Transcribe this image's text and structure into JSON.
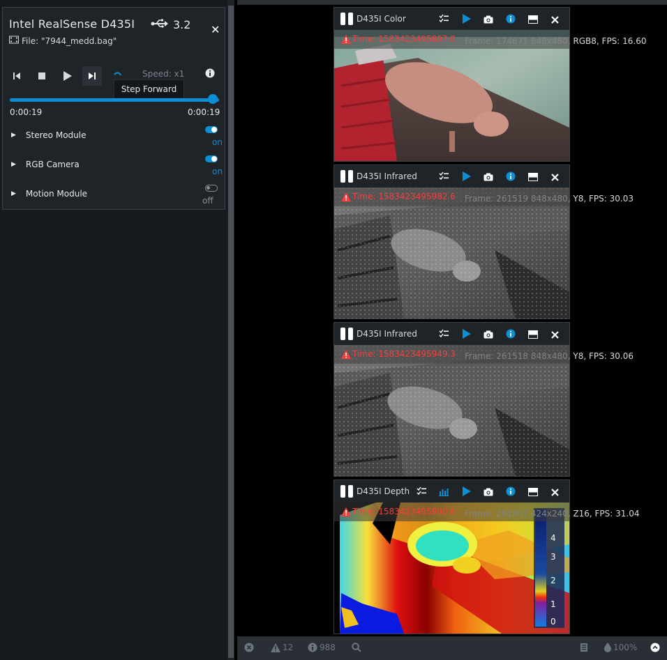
{
  "device": {
    "title": "Intel RealSense D435I",
    "usb_version": "3.2",
    "file_label": "File: \"7944_medd.bag\"",
    "speed_label": "Speed: x1",
    "tooltip": "Step Forward",
    "time_start": "0:00:19",
    "time_end": "0:00:19",
    "progress": 1.0,
    "modules": [
      {
        "label": "Stereo Module",
        "state": "on"
      },
      {
        "label": "RGB Camera",
        "state": "on"
      },
      {
        "label": "Motion Module",
        "state": "off"
      }
    ]
  },
  "streams": [
    {
      "name": "D435I Color",
      "time": "Time: 1583423495897.0",
      "info": "Frame: 174671  848x480,  RGB8,   FPS:  16.60"
    },
    {
      "name": "D435I Infrared",
      "time": "Time: 1583423495982.6",
      "info": "Frame: 261519  848x480,  Y8,   FPS:  30.03"
    },
    {
      "name": "D435I Infrared",
      "time": "Time: 1583423495949.3",
      "info": "Frame: 261518  848x480,  Y8,   FPS:  30.06"
    },
    {
      "name": "D435I Depth",
      "time": "Time: 1583423495990.6",
      "info": "Frame: 261807  424x240,  Z16,   FPS:  31.04"
    }
  ],
  "depth_scale": [
    "4",
    "3",
    "2",
    "1",
    "0"
  ],
  "statusbar": {
    "warnings": "12",
    "info": "988",
    "opacity": "100%"
  },
  "colors": {
    "accent": "#0c8fd6",
    "warning": "#ff3b3b",
    "panel": "#1f2429"
  }
}
